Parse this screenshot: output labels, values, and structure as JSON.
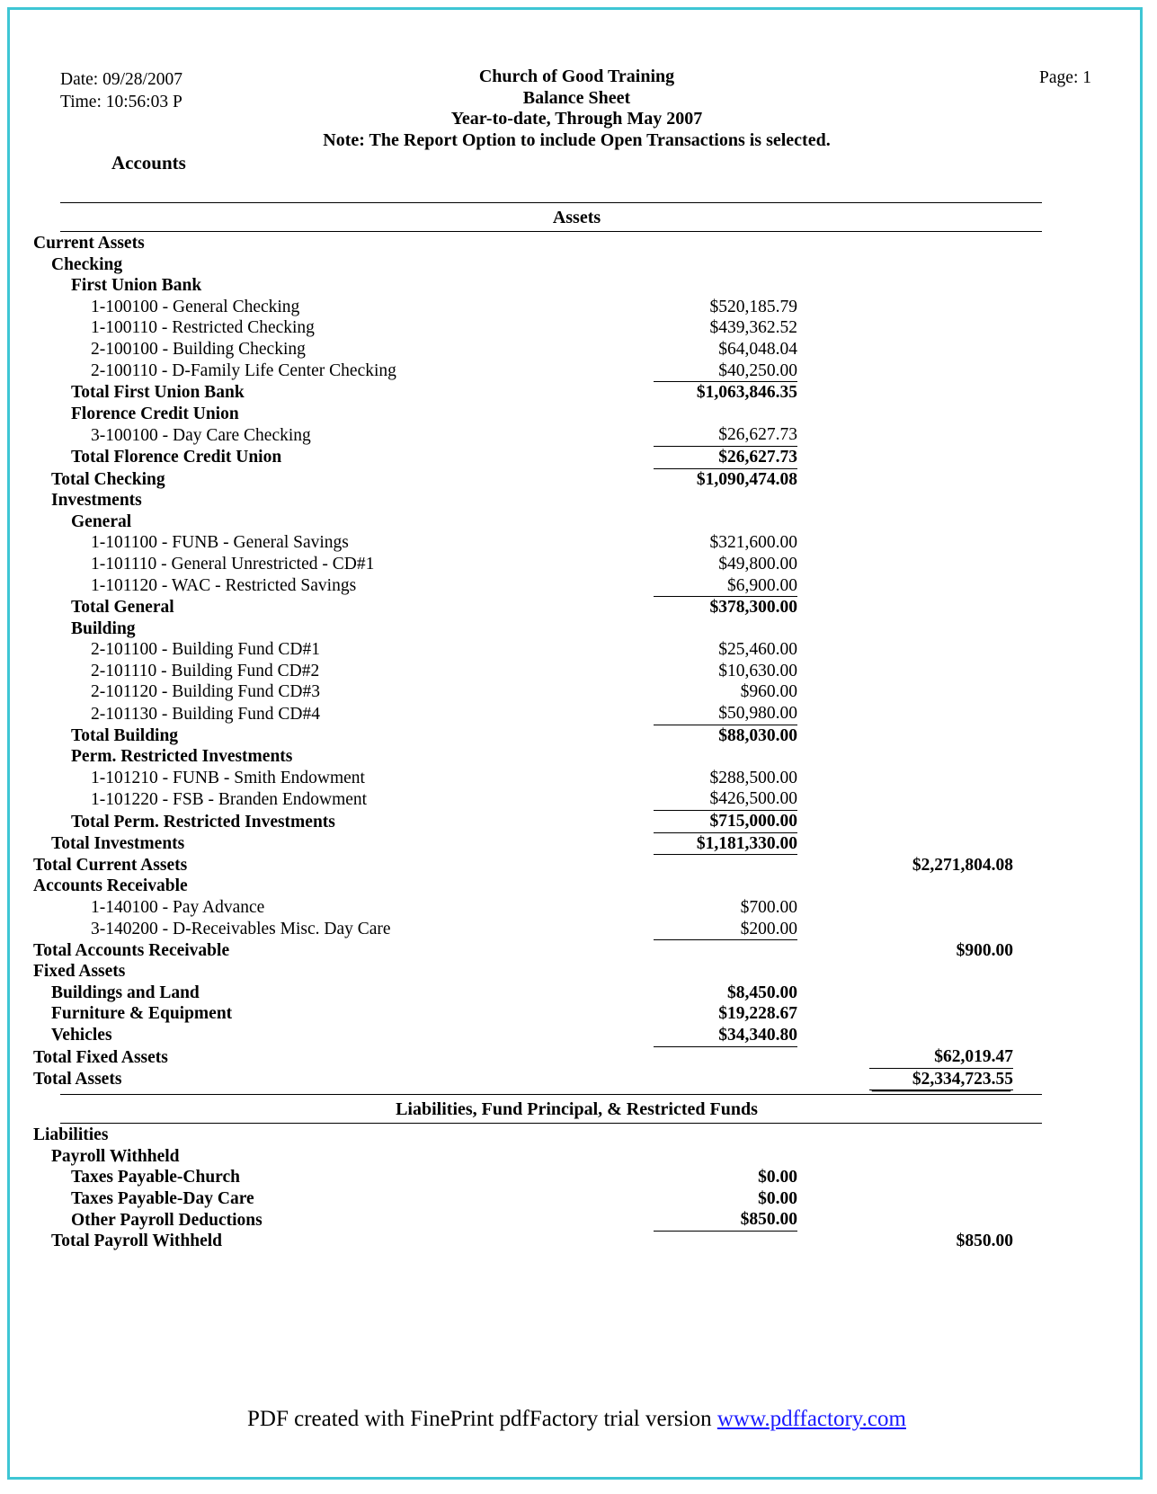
{
  "header": {
    "date_line": "Date: 09/28/2007",
    "time_line": "Time: 10:56:03 P",
    "org": "Church of Good Training",
    "report_title": "Balance Sheet",
    "period": "Year-to-date, Through May 2007",
    "note": "Note: The Report Option to include Open Transactions is selected.",
    "page": "Page: 1",
    "accounts_label": "Accounts"
  },
  "assets_section": {
    "title": "Assets",
    "rows": [
      {
        "label": "Current Assets",
        "indent": 0,
        "bold": true,
        "amt1": "",
        "amt2": ""
      },
      {
        "label": "Checking",
        "indent": 1,
        "bold": true,
        "amt1": "",
        "amt2": ""
      },
      {
        "label": "First Union Bank",
        "indent": 2,
        "bold": true,
        "amt1": "",
        "amt2": ""
      },
      {
        "label": "1-100100 - General Checking",
        "indent": 3,
        "bold": false,
        "amt1": "$520,185.79",
        "amt2": ""
      },
      {
        "label": "1-100110 - Restricted Checking",
        "indent": 3,
        "bold": false,
        "amt1": "$439,362.52",
        "amt2": ""
      },
      {
        "label": "2-100100 - Building Checking",
        "indent": 3,
        "bold": false,
        "amt1": "$64,048.04",
        "amt2": ""
      },
      {
        "label": "2-100110 - D-Family Life Center Checking",
        "indent": 3,
        "bold": false,
        "amt1": "$40,250.00",
        "amt2": "",
        "rule1": true
      },
      {
        "label": "Total First Union Bank",
        "indent": 2,
        "bold": true,
        "amt1": "$1,063,846.35",
        "amt2": ""
      },
      {
        "label": "Florence Credit Union",
        "indent": 2,
        "bold": true,
        "amt1": "",
        "amt2": ""
      },
      {
        "label": "3-100100 - Day Care Checking",
        "indent": 3,
        "bold": false,
        "amt1": "$26,627.73",
        "amt2": "",
        "rule1": true
      },
      {
        "label": "Total Florence Credit Union",
        "indent": 2,
        "bold": true,
        "amt1": "$26,627.73",
        "amt2": "",
        "rule1": true
      },
      {
        "label": "Total Checking",
        "indent": 1,
        "bold": true,
        "amt1": "$1,090,474.08",
        "amt2": ""
      },
      {
        "label": "Investments",
        "indent": 1,
        "bold": true,
        "amt1": "",
        "amt2": ""
      },
      {
        "label": "General",
        "indent": 2,
        "bold": true,
        "amt1": "",
        "amt2": ""
      },
      {
        "label": "1-101100 - FUNB - General Savings",
        "indent": 3,
        "bold": false,
        "amt1": "$321,600.00",
        "amt2": ""
      },
      {
        "label": "1-101110 - General Unrestricted - CD#1",
        "indent": 3,
        "bold": false,
        "amt1": "$49,800.00",
        "amt2": ""
      },
      {
        "label": "1-101120 - WAC - Restricted Savings",
        "indent": 3,
        "bold": false,
        "amt1": "$6,900.00",
        "amt2": "",
        "rule1": true
      },
      {
        "label": "Total General",
        "indent": 2,
        "bold": true,
        "amt1": "$378,300.00",
        "amt2": ""
      },
      {
        "label": "Building",
        "indent": 2,
        "bold": true,
        "amt1": "",
        "amt2": ""
      },
      {
        "label": "2-101100 - Building Fund CD#1",
        "indent": 3,
        "bold": false,
        "amt1": "$25,460.00",
        "amt2": ""
      },
      {
        "label": "2-101110 - Building Fund CD#2",
        "indent": 3,
        "bold": false,
        "amt1": "$10,630.00",
        "amt2": ""
      },
      {
        "label": "2-101120 - Building Fund CD#3",
        "indent": 3,
        "bold": false,
        "amt1": "$960.00",
        "amt2": ""
      },
      {
        "label": "2-101130 - Building Fund CD#4",
        "indent": 3,
        "bold": false,
        "amt1": "$50,980.00",
        "amt2": "",
        "rule1": true
      },
      {
        "label": "Total Building",
        "indent": 2,
        "bold": true,
        "amt1": "$88,030.00",
        "amt2": ""
      },
      {
        "label": "Perm. Restricted Investments",
        "indent": 2,
        "bold": true,
        "amt1": "",
        "amt2": ""
      },
      {
        "label": "1-101210 - FUNB - Smith Endowment",
        "indent": 3,
        "bold": false,
        "amt1": "$288,500.00",
        "amt2": ""
      },
      {
        "label": "1-101220 - FSB - Branden Endowment",
        "indent": 3,
        "bold": false,
        "amt1": "$426,500.00",
        "amt2": "",
        "rule1": true
      },
      {
        "label": "Total Perm. Restricted Investments",
        "indent": 2,
        "bold": true,
        "amt1": "$715,000.00",
        "amt2": "",
        "rule1": true
      },
      {
        "label": "Total Investments",
        "indent": 1,
        "bold": true,
        "amt1": "$1,181,330.00",
        "amt2": "",
        "rule1": true
      },
      {
        "label": "Total Current Assets",
        "indent": 0,
        "bold": true,
        "amt1": "",
        "amt2": "$2,271,804.08"
      },
      {
        "label": "Accounts Receivable",
        "indent": 0,
        "bold": true,
        "amt1": "",
        "amt2": ""
      },
      {
        "label": "1-140100 - Pay Advance",
        "indent": 3,
        "bold": false,
        "amt1": "$700.00",
        "amt2": ""
      },
      {
        "label": "3-140200 - D-Receivables Misc. Day Care",
        "indent": 3,
        "bold": false,
        "amt1": "$200.00",
        "amt2": "",
        "rule1": true
      },
      {
        "label": "Total Accounts Receivable",
        "indent": 0,
        "bold": true,
        "amt1": "",
        "amt2": "$900.00"
      },
      {
        "label": "Fixed Assets",
        "indent": 0,
        "bold": true,
        "amt1": "",
        "amt2": ""
      },
      {
        "label": "Buildings and Land",
        "indent": 1,
        "bold": true,
        "amt1": "$8,450.00",
        "amt2": ""
      },
      {
        "label": "Furniture & Equipment",
        "indent": 1,
        "bold": true,
        "amt1": "$19,228.67",
        "amt2": ""
      },
      {
        "label": "Vehicles",
        "indent": 1,
        "bold": true,
        "amt1": "$34,340.80",
        "amt2": "",
        "rule1": true
      },
      {
        "label": "Total Fixed Assets",
        "indent": 0,
        "bold": true,
        "amt1": "",
        "amt2": "$62,019.47",
        "rule2": true
      },
      {
        "label": "Total Assets",
        "indent": 0,
        "bold": true,
        "amt1": "",
        "amt2": "$2,334,723.55",
        "double2": true
      }
    ]
  },
  "liabilities_section": {
    "title": "Liabilities, Fund Principal, & Restricted Funds",
    "rows": [
      {
        "label": "Liabilities",
        "indent": 0,
        "bold": true,
        "amt1": "",
        "amt2": ""
      },
      {
        "label": "Payroll Withheld",
        "indent": 1,
        "bold": true,
        "amt1": "",
        "amt2": ""
      },
      {
        "label": "Taxes Payable-Church",
        "indent": 2,
        "bold": true,
        "amt1": "$0.00",
        "amt2": ""
      },
      {
        "label": "Taxes Payable-Day Care",
        "indent": 2,
        "bold": true,
        "amt1": "$0.00",
        "amt2": ""
      },
      {
        "label": "Other Payroll Deductions",
        "indent": 2,
        "bold": true,
        "amt1": "$850.00",
        "amt2": "",
        "rule1": true
      },
      {
        "label": "Total Payroll Withheld",
        "indent": 1,
        "bold": true,
        "amt1": "",
        "amt2": "$850.00"
      }
    ]
  },
  "footer": {
    "text_before": "PDF created with FinePrint pdfFactory trial version ",
    "link": "www.pdffactory.com"
  }
}
